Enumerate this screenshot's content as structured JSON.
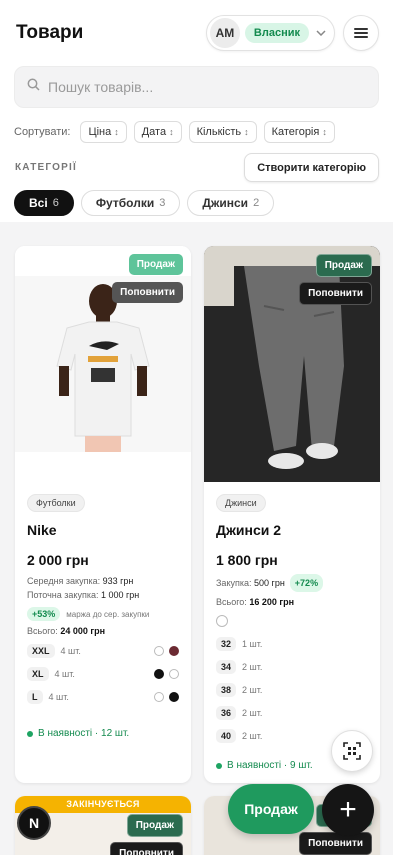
{
  "header": {
    "title": "Товари",
    "avatar_initials": "АМ",
    "role": "Власник"
  },
  "search": {
    "placeholder": "Пошук товарів..."
  },
  "sort": {
    "label": "Сортувати:",
    "options": [
      "Ціна",
      "Дата",
      "Кількість",
      "Категорія"
    ]
  },
  "categories": {
    "heading": "КАТЕГОРІЇ",
    "create_label": "Створити категорію",
    "chips": [
      {
        "label": "Всі",
        "count": "6"
      },
      {
        "label": "Футболки",
        "count": "3"
      },
      {
        "label": "Джинси",
        "count": "2"
      }
    ]
  },
  "products": [
    {
      "sale_badge": "Продаж",
      "restock_badge": "Поповнити",
      "category": "Футболки",
      "name": "Nike",
      "price": "2 000 грн",
      "avg_purchase_label": "Середня закупка:",
      "avg_purchase": "933 грн",
      "current_purchase_label": "Поточна закупка:",
      "current_purchase": "1 000 грн",
      "margin": "+53%",
      "margin_note": "маржа до сер. закупки",
      "total_label": "Всього:",
      "total": "24 000 грн",
      "sizes": [
        {
          "size": "XXL",
          "qty": "4 шт."
        },
        {
          "size": "XL",
          "qty": "4 шт."
        },
        {
          "size": "L",
          "qty": "4 шт."
        }
      ],
      "stock": "В наявності · 12 шт."
    },
    {
      "sale_badge": "Продаж",
      "restock_badge": "Поповнити",
      "category": "Джинси",
      "name": "Джинси 2",
      "price": "1 800 грн",
      "purchase_label": "Закупка:",
      "purchase": "500 грн",
      "margin": "+72%",
      "total_label": "Всього:",
      "total": "16 200 грн",
      "sizes": [
        {
          "size": "32",
          "qty": "1 шт."
        },
        {
          "size": "34",
          "qty": "2 шт."
        },
        {
          "size": "38",
          "qty": "2 шт."
        },
        {
          "size": "36",
          "qty": "2 шт."
        },
        {
          "size": "40",
          "qty": "2 шт."
        }
      ],
      "stock": "В наявності · 9 шт."
    },
    {
      "ending_badge": "ЗАКІНЧУЄТЬСЯ",
      "sale_badge": "Продаж",
      "restock_badge": "Поповнити"
    },
    {
      "sale_badge": "Продаж",
      "restock_badge": "Поповнити"
    }
  ],
  "fab": {
    "sale_label": "Продаж",
    "add_label": "+",
    "n_label": "N"
  },
  "colors": {
    "accent_green": "#1f9a5e",
    "swatch_burgundy": "#6b2a32",
    "swatch_black": "#111111",
    "ending_yellow": "#f5b301"
  }
}
